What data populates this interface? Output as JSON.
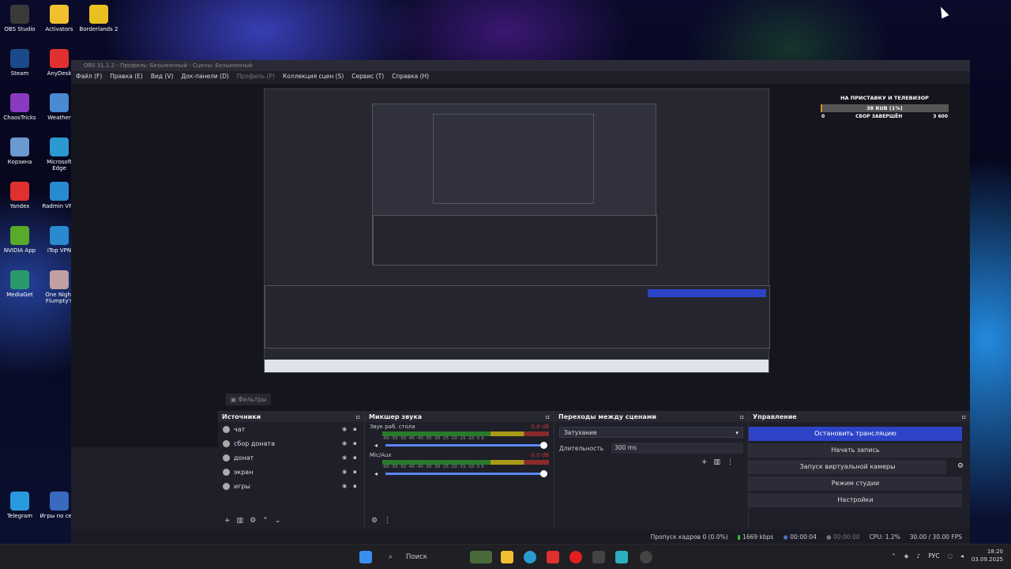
{
  "desktop": {
    "icons": [
      {
        "label": "OBS Studio",
        "color": "#3a3a3a"
      },
      {
        "label": "Activators",
        "color": "#f0c030"
      },
      {
        "label": "Borderlands 2",
        "color": "#e8c020"
      },
      {
        "label": "Steam",
        "color": "#1b4a8a"
      },
      {
        "label": "AnyDesk",
        "color": "#e03030"
      },
      {
        "label": "ChaosTricks",
        "color": "#8a3ac0"
      },
      {
        "label": "Weather",
        "color": "#4a8ad0"
      },
      {
        "label": "Корзина",
        "color": "#6a9ad0"
      },
      {
        "label": "Microsoft Edge",
        "color": "#2a9ad0"
      },
      {
        "label": "Yandex",
        "color": "#e03030"
      },
      {
        "label": "Radmin VPN",
        "color": "#2a8ad0"
      },
      {
        "label": "NVIDIA App",
        "color": "#5aaa2a"
      },
      {
        "label": "iTop VPN",
        "color": "#2a8ad0"
      },
      {
        "label": "MediaGet",
        "color": "#2a9a6a"
      },
      {
        "label": "One Night Flumpty's",
        "color": "#c0a0a0"
      },
      {
        "label": "Telegram",
        "color": "#2a9ae0"
      },
      {
        "label": "Игры по сети",
        "color": "#3a6ac0"
      }
    ]
  },
  "obs": {
    "title": "OBS 31.1.2 - Профиль: Безымянный - Сцены: Безымянный",
    "menu": [
      {
        "label": "Файл (F)",
        "dim": false
      },
      {
        "label": "Правка (E)",
        "dim": false
      },
      {
        "label": "Вид (V)",
        "dim": false
      },
      {
        "label": "Док-панели (D)",
        "dim": false
      },
      {
        "label": "Профиль (P)",
        "dim": true
      },
      {
        "label": "Коллекция сцен (S)",
        "dim": false
      },
      {
        "label": "Сервис (T)",
        "dim": false
      },
      {
        "label": "Справка (H)",
        "dim": false
      }
    ],
    "widget": {
      "title": "НА ПРИСТАВКУ И ТЕЛЕВИЗОР",
      "amount": "38 RUB (1%)",
      "progress_percent": 1,
      "left": "0",
      "status": "СБОР ЗАВЕРШЁН",
      "right": "3 600"
    },
    "filters_label": "Фильтры",
    "sources": {
      "title": "Источники",
      "items": [
        "чат",
        "сбор доната",
        "донат",
        "экран",
        "игры"
      ]
    },
    "mixer": {
      "title": "Микшер звука",
      "ticks": "-60  -55  -50  -45  -40  -35  -30  -25  -20  -15  -10  -5  0",
      "channels": [
        {
          "name": "Звук раб. стола",
          "db": "0.0 dB"
        },
        {
          "name": "Mic/Aux",
          "db": "0.0 dB"
        }
      ]
    },
    "transitions": {
      "title": "Переходы между сценами",
      "selected": "Затухание",
      "duration_label": "Длительность",
      "duration_value": "300 ms"
    },
    "controls": {
      "title": "Управление",
      "stop_stream": "Остановить трансляцию",
      "start_record": "Начать запись",
      "virtual_cam": "Запуск виртуальной камеры",
      "studio_mode": "Режим студии",
      "settings": "Настройки"
    },
    "status": {
      "dropped": "Пропуск кадров 0 (0.0%)",
      "bitrate": "1669 kbps",
      "stream_time": "00:00:04",
      "rec_time": "00:00:00",
      "cpu": "CPU: 1.2%",
      "fps": "30.00 / 30.00 FPS"
    }
  },
  "taskbar": {
    "search_placeholder": "Поиск",
    "lang": "РУС",
    "time": "18:20",
    "date": "03.09.2025"
  }
}
